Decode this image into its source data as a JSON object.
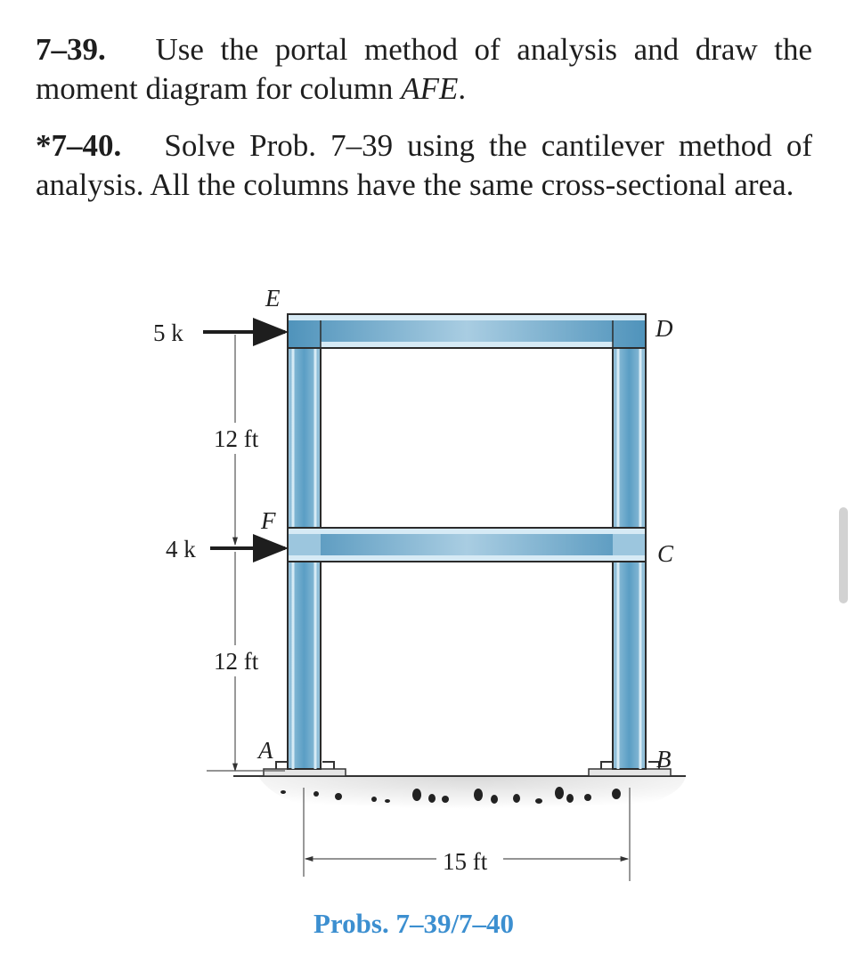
{
  "problems": [
    {
      "number": "7–39.",
      "text_line1": "Use the portal method of analysis and draw the",
      "text_line2_prefix": "moment diagram for column ",
      "text_line2_italic": "AFE",
      "text_line2_suffix": "."
    },
    {
      "number": "*7–40.",
      "text_line1": "Solve Prob. 7–39 using the cantilever method of",
      "text_line2": "analysis. All the columns have the same cross-sectional area."
    }
  ],
  "figure": {
    "joint_labels": {
      "E": "E",
      "D": "D",
      "F": "F",
      "C": "C",
      "A": "A",
      "B": "B"
    },
    "loads": [
      {
        "label": "5 k",
        "joint": "E"
      },
      {
        "label": "4 k",
        "joint": "F"
      }
    ],
    "dimensions": {
      "upper_story": "12 ft",
      "lower_story": "12 ft",
      "bay_width": "15 ft"
    },
    "colors": {
      "member_fill": "#5a9ec4",
      "member_light": "#bcdcef",
      "member_edge": "#2b2b2b",
      "caption": "#3c8fd0"
    }
  },
  "caption": "Probs. 7–39/7–40"
}
